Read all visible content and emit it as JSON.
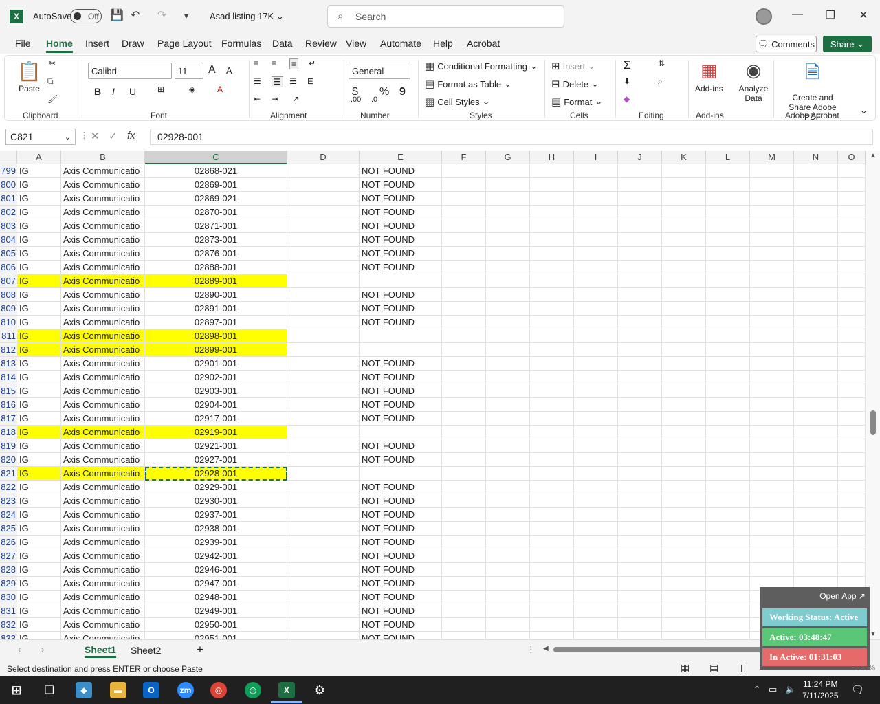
{
  "titlebar": {
    "app_logo": "X",
    "autosave_label": "AutoSave",
    "autosave_state": "Off",
    "doc_title": "Asad listing 17K",
    "search_placeholder": "Search"
  },
  "menu": {
    "items": [
      "File",
      "Home",
      "Insert",
      "Draw",
      "Page Layout",
      "Formulas",
      "Data",
      "Review",
      "View",
      "Automate",
      "Help",
      "Acrobat"
    ],
    "active": "Home",
    "comments_label": "Comments",
    "share_label": "Share"
  },
  "ribbon": {
    "clipboard": {
      "paste": "Paste",
      "label": "Clipboard"
    },
    "font": {
      "name": "Calibri",
      "size": "11",
      "label": "Font",
      "bold": "B",
      "italic": "I",
      "underline": "U",
      "grow": "A",
      "shrink": "A"
    },
    "alignment": {
      "label": "Alignment"
    },
    "number": {
      "format": "General",
      "label": "Number",
      "currency": "$",
      "percent": "%",
      "comma": "9"
    },
    "styles": {
      "conditional": "Conditional Formatting",
      "table": "Format as Table",
      "cell_styles": "Cell Styles",
      "label": "Styles"
    },
    "cells": {
      "insert": "Insert",
      "delete": "Delete",
      "format": "Format",
      "label": "Cells"
    },
    "editing": {
      "label": "Editing"
    },
    "addins": {
      "addins": "Add-ins",
      "label": "Add-ins",
      "analyze": "Analyze Data"
    },
    "acrobat": {
      "create": "Create and Share Adobe PDF",
      "label": "Adobe Acrobat"
    }
  },
  "formula_bar": {
    "name_box": "C821",
    "fx": "fx",
    "value": "02928-001"
  },
  "columns": [
    "A",
    "B",
    "C",
    "D",
    "E",
    "F",
    "G",
    "H",
    "I",
    "J",
    "K",
    "L",
    "M",
    "N",
    "O"
  ],
  "selected_column": "C",
  "rows": [
    {
      "n": "799",
      "a": "IG",
      "b": "Axis Communicatio",
      "c": "02868-021",
      "e": "NOT FOUND",
      "hl": false
    },
    {
      "n": "800",
      "a": "IG",
      "b": "Axis Communicatio",
      "c": "02869-001",
      "e": "NOT FOUND",
      "hl": false
    },
    {
      "n": "801",
      "a": "IG",
      "b": "Axis Communicatio",
      "c": "02869-021",
      "e": "NOT FOUND",
      "hl": false
    },
    {
      "n": "802",
      "a": "IG",
      "b": "Axis Communicatio",
      "c": "02870-001",
      "e": "NOT FOUND",
      "hl": false
    },
    {
      "n": "803",
      "a": "IG",
      "b": "Axis Communicatio",
      "c": "02871-001",
      "e": "NOT FOUND",
      "hl": false
    },
    {
      "n": "804",
      "a": "IG",
      "b": "Axis Communicatio",
      "c": "02873-001",
      "e": "NOT FOUND",
      "hl": false
    },
    {
      "n": "805",
      "a": "IG",
      "b": "Axis Communicatio",
      "c": "02876-001",
      "e": "NOT FOUND",
      "hl": false
    },
    {
      "n": "806",
      "a": "IG",
      "b": "Axis Communicatio",
      "c": "02888-001",
      "e": "NOT FOUND",
      "hl": false
    },
    {
      "n": "807",
      "a": "IG",
      "b": "Axis Communicatio",
      "c": "02889-001",
      "e": "",
      "hl": true
    },
    {
      "n": "808",
      "a": "IG",
      "b": "Axis Communicatio",
      "c": "02890-001",
      "e": "NOT FOUND",
      "hl": false
    },
    {
      "n": "809",
      "a": "IG",
      "b": "Axis Communicatio",
      "c": "02891-001",
      "e": "NOT FOUND",
      "hl": false
    },
    {
      "n": "810",
      "a": "IG",
      "b": "Axis Communicatio",
      "c": "02897-001",
      "e": "NOT FOUND",
      "hl": false
    },
    {
      "n": "811",
      "a": "IG",
      "b": "Axis Communicatio",
      "c": "02898-001",
      "e": "",
      "hl": true
    },
    {
      "n": "812",
      "a": "IG",
      "b": "Axis Communicatio",
      "c": "02899-001",
      "e": "",
      "hl": true
    },
    {
      "n": "813",
      "a": "IG",
      "b": "Axis Communicatio",
      "c": "02901-001",
      "e": "NOT FOUND",
      "hl": false
    },
    {
      "n": "814",
      "a": "IG",
      "b": "Axis Communicatio",
      "c": "02902-001",
      "e": "NOT FOUND",
      "hl": false
    },
    {
      "n": "815",
      "a": "IG",
      "b": "Axis Communicatio",
      "c": "02903-001",
      "e": "NOT FOUND",
      "hl": false
    },
    {
      "n": "816",
      "a": "IG",
      "b": "Axis Communicatio",
      "c": "02904-001",
      "e": "NOT FOUND",
      "hl": false
    },
    {
      "n": "817",
      "a": "IG",
      "b": "Axis Communicatio",
      "c": "02917-001",
      "e": "NOT FOUND",
      "hl": false
    },
    {
      "n": "818",
      "a": "IG",
      "b": "Axis Communicatio",
      "c": "02919-001",
      "e": "",
      "hl": true
    },
    {
      "n": "819",
      "a": "IG",
      "b": "Axis Communicatio",
      "c": "02921-001",
      "e": "NOT FOUND",
      "hl": false
    },
    {
      "n": "820",
      "a": "IG",
      "b": "Axis Communicatio",
      "c": "02927-001",
      "e": "NOT FOUND",
      "hl": false
    },
    {
      "n": "821",
      "a": "IG",
      "b": "Axis Communicatio",
      "c": "02928-001",
      "e": "",
      "hl": true,
      "selected": true
    },
    {
      "n": "822",
      "a": "IG",
      "b": "Axis Communicatio",
      "c": "02929-001",
      "e": "NOT FOUND",
      "hl": false
    },
    {
      "n": "823",
      "a": "IG",
      "b": "Axis Communicatio",
      "c": "02930-001",
      "e": "NOT FOUND",
      "hl": false
    },
    {
      "n": "824",
      "a": "IG",
      "b": "Axis Communicatio",
      "c": "02937-001",
      "e": "NOT FOUND",
      "hl": false
    },
    {
      "n": "825",
      "a": "IG",
      "b": "Axis Communicatio",
      "c": "02938-001",
      "e": "NOT FOUND",
      "hl": false
    },
    {
      "n": "826",
      "a": "IG",
      "b": "Axis Communicatio",
      "c": "02939-001",
      "e": "NOT FOUND",
      "hl": false
    },
    {
      "n": "827",
      "a": "IG",
      "b": "Axis Communicatio",
      "c": "02942-001",
      "e": "NOT FOUND",
      "hl": false
    },
    {
      "n": "828",
      "a": "IG",
      "b": "Axis Communicatio",
      "c": "02946-001",
      "e": "NOT FOUND",
      "hl": false
    },
    {
      "n": "829",
      "a": "IG",
      "b": "Axis Communicatio",
      "c": "02947-001",
      "e": "NOT FOUND",
      "hl": false
    },
    {
      "n": "830",
      "a": "IG",
      "b": "Axis Communicatio",
      "c": "02948-001",
      "e": "NOT FOUND",
      "hl": false
    },
    {
      "n": "831",
      "a": "IG",
      "b": "Axis Communicatio",
      "c": "02949-001",
      "e": "NOT FOUND",
      "hl": false
    },
    {
      "n": "832",
      "a": "IG",
      "b": "Axis Communicatio",
      "c": "02950-001",
      "e": "NOT FOUND",
      "hl": false
    },
    {
      "n": "833",
      "a": "IG",
      "b": "Axis Communicatio",
      "c": "02951-001",
      "e": "NOT FOUND",
      "hl": false
    }
  ],
  "sheets": [
    "Sheet1",
    "Sheet2"
  ],
  "active_sheet": "Sheet1",
  "status": {
    "message": "Select destination and press ENTER or choose Paste",
    "zoom": "100%"
  },
  "monitor": {
    "open_app": "Open App ↗",
    "working": "Working Status: Active",
    "active": "Active: 03:48:47",
    "inactive": "In Active: 01:31:03"
  },
  "taskbar": {
    "time": "11:24 PM",
    "date": "7/11/2025"
  },
  "colors": {
    "accent": "#1d6f42",
    "highlight": "#ffff00",
    "row_number": "#1b3f8f"
  }
}
